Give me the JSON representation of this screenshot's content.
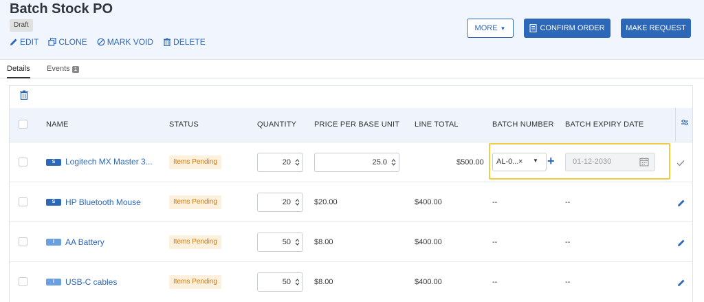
{
  "header": {
    "title": "Batch Stock PO",
    "status_badge": "Draft",
    "actions": {
      "edit": "EDIT",
      "clone": "CLONE",
      "mark_void": "MARK VOID",
      "delete": "DELETE"
    },
    "buttons": {
      "more": "MORE",
      "confirm_order": "CONFIRM ORDER",
      "make_request": "MAKE REQUEST"
    }
  },
  "tabs": {
    "details": "Details",
    "events": "Events",
    "events_count": "1"
  },
  "table": {
    "columns": {
      "name": "NAME",
      "status": "STATUS",
      "quantity": "QUANTITY",
      "price_per_base_unit": "PRICE PER BASE UNIT",
      "line_total": "LINE TOTAL",
      "batch_number": "BATCH NUMBER",
      "batch_expiry_date": "BATCH EXPIRY DATE"
    },
    "rows": [
      {
        "type_tag": "S",
        "name": "Logitech MX Master 3...",
        "status": "Items Pending",
        "quantity": "20",
        "price": "25.0",
        "line_total": "$500.00",
        "batch_number": "AL-0...",
        "batch_clear": "×",
        "batch_caret": "▼",
        "add": "+",
        "expiry": "01-12-2030"
      },
      {
        "type_tag": "S",
        "name": "HP Bluetooth Mouse",
        "status": "Items Pending",
        "quantity": "20",
        "price": "$20.00",
        "line_total": "$400.00",
        "batch_number": "--",
        "expiry": "--"
      },
      {
        "type_tag": "I",
        "name": "AA Battery",
        "status": "Items Pending",
        "quantity": "50",
        "price": "$8.00",
        "line_total": "$400.00",
        "batch_number": "--",
        "expiry": "--"
      },
      {
        "type_tag": "I",
        "name": "USB-C cables",
        "status": "Items Pending",
        "quantity": "50",
        "price": "$8.00",
        "line_total": "$400.00",
        "batch_number": "--",
        "expiry": "--"
      }
    ]
  },
  "colors": {
    "accent": "#2d67b8",
    "header_bg": "#f1f5fd",
    "status_bg": "#fdf0dc",
    "status_text": "#c97a14",
    "highlight": "#f1cc40"
  }
}
